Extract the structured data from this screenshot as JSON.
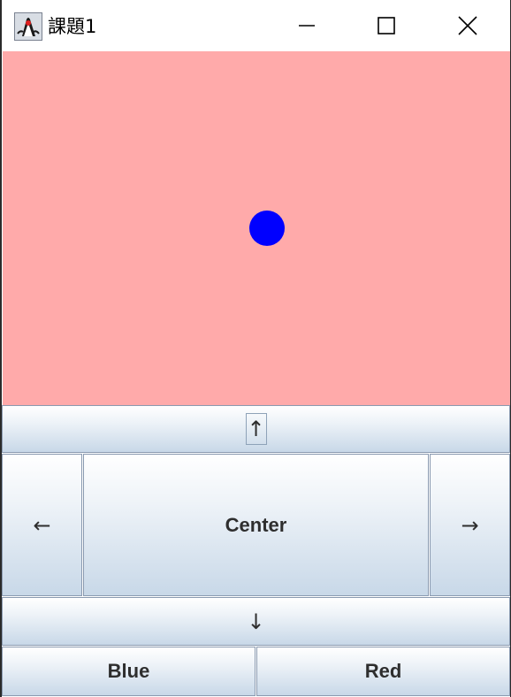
{
  "window": {
    "title": "課題1"
  },
  "canvas": {
    "background": "#ffaaaa",
    "ball_color": "#0000ff"
  },
  "controls": {
    "up": "↑",
    "left": "←",
    "center": "Center",
    "right": "→",
    "down": "↓",
    "blue": "Blue",
    "red": "Red"
  },
  "icons": {
    "app": "java-duke-icon",
    "minimize": "minimize-icon",
    "maximize": "maximize-icon",
    "close": "close-icon"
  }
}
